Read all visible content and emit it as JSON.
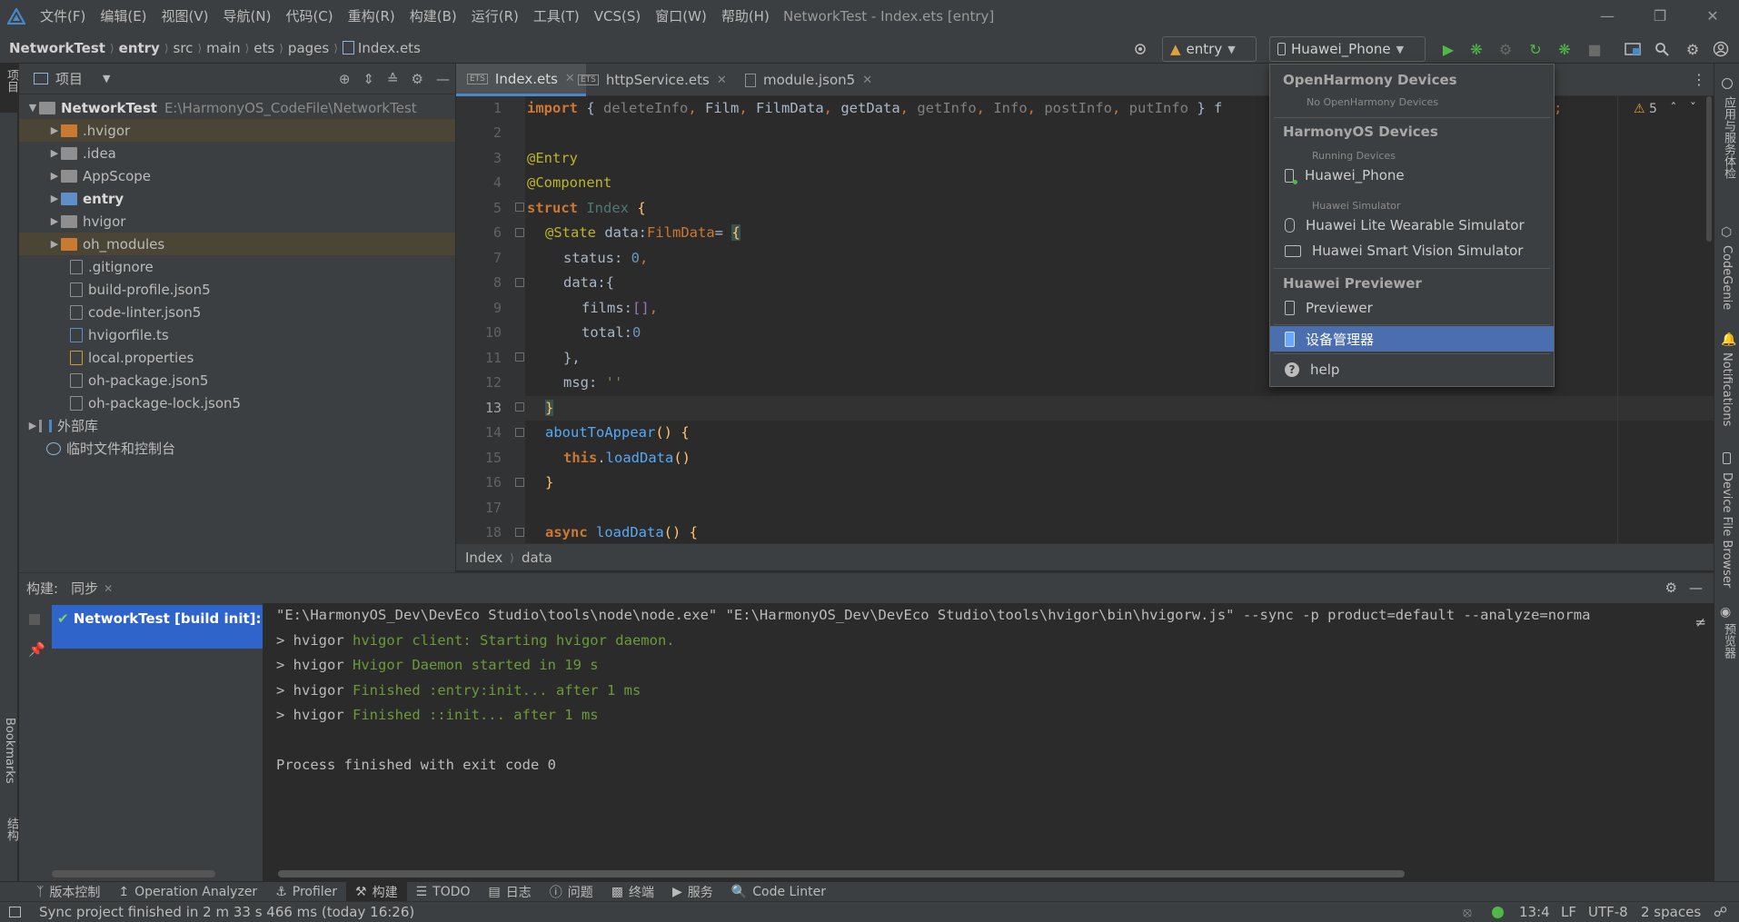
{
  "menubar": {
    "items": [
      "文件(F)",
      "编辑(E)",
      "视图(V)",
      "导航(N)",
      "代码(C)",
      "重构(R)",
      "构建(B)",
      "运行(R)",
      "工具(T)",
      "VCS(S)",
      "窗口(W)",
      "帮助(H)"
    ],
    "window_title": "NetworkTest - Index.ets [entry]"
  },
  "breadcrumb": [
    "NetworkTest",
    "entry",
    "src",
    "main",
    "ets",
    "pages",
    "Index.ets"
  ],
  "toolbar": {
    "module_select": "entry",
    "device_select": "Huawei_Phone"
  },
  "project_panel": {
    "title": "项目",
    "tree": [
      {
        "label": "NetworkTest",
        "path": "E:\\HarmonyOS_CodeFile\\NetworkTest",
        "depth": 0,
        "kind": "root"
      },
      {
        "label": ".hvigor",
        "depth": 1,
        "kind": "folder-orange"
      },
      {
        "label": ".idea",
        "depth": 1,
        "kind": "folder"
      },
      {
        "label": "AppScope",
        "depth": 1,
        "kind": "folder"
      },
      {
        "label": "entry",
        "depth": 1,
        "kind": "folder-blue"
      },
      {
        "label": "hvigor",
        "depth": 1,
        "kind": "folder"
      },
      {
        "label": "oh_modules",
        "depth": 1,
        "kind": "folder-orange"
      },
      {
        "label": ".gitignore",
        "depth": 1,
        "kind": "file"
      },
      {
        "label": "build-profile.json5",
        "depth": 1,
        "kind": "file"
      },
      {
        "label": "code-linter.json5",
        "depth": 1,
        "kind": "file"
      },
      {
        "label": "hvigorfile.ts",
        "depth": 1,
        "kind": "file"
      },
      {
        "label": "local.properties",
        "depth": 1,
        "kind": "file"
      },
      {
        "label": "oh-package.json5",
        "depth": 1,
        "kind": "file"
      },
      {
        "label": "oh-package-lock.json5",
        "depth": 1,
        "kind": "file"
      },
      {
        "label": "外部库",
        "depth": 0,
        "kind": "lib"
      },
      {
        "label": "临时文件和控制台",
        "depth": 0,
        "kind": "scratch"
      }
    ]
  },
  "editor": {
    "tabs": [
      "Index.ets",
      "httpService.ets",
      "module.json5"
    ],
    "warnings": "5",
    "line_numbers": [
      "1",
      "2",
      "3",
      "4",
      "5",
      "6",
      "7",
      "8",
      "9",
      "10",
      "11",
      "12",
      "13",
      "14",
      "15",
      "16",
      "17",
      "18"
    ],
    "code": {
      "l1_import": "import",
      "l1_a": "{ ",
      "l1_deleteInfo": "deleteInfo",
      "l1_film": "Film",
      "l1_filmdata": "FilmData",
      "l1_getdata": "getData",
      "l1_getinfo": "getInfo",
      "l1_info": "Info",
      "l1_postinfo": "postInfo",
      "l1_putinfo": "putInfo",
      "l1_end": " } f",
      "l1_semicolon": ";",
      "l4": "@Entry",
      "l5": "@Component",
      "l6_struct": "struct",
      "l6_name": "Index",
      "l6_brace": " {",
      "l7_state": "@State",
      "l7_var": " data:",
      "l7_type": "FilmData",
      "l7_eq": "= ",
      "l7_brace": "{",
      "l8_key": "status",
      "l8_val": "0",
      "l9": "data:{",
      "l10_key": "films",
      "l10_val": "[]",
      "l11_key": "total",
      "l11_val": "0",
      "l12": "},",
      "l13_key": "msg",
      "l13_val": "''",
      "l14": "}",
      "l15_fn": "aboutToAppear",
      "l15_rest": "() {",
      "l16_this": "this",
      "l16_fn": "loadData",
      "l16_rest": "()",
      "l17": "}",
      "l19_async": "async",
      "l19_fn": "loadData",
      "l19_rest": "() {"
    },
    "crumbs": [
      "Index",
      "data"
    ]
  },
  "build": {
    "label": "构建:",
    "tab": "同步",
    "tree_item": "NetworkTest [build init]: 成",
    "console": [
      "\"E:\\HarmonyOS_Dev\\DevEco Studio\\tools\\node\\node.exe\" \"E:\\HarmonyOS_Dev\\DevEco Studio\\tools\\hvigor\\bin\\hvigorw.js\" --sync -p product=default --analyze=norma",
      "> hvigor ",
      "hvigor client: Starting hvigor daemon.",
      "> hvigor ",
      "Hvigor Daemon started in 19 s",
      "> hvigor ",
      "Finished :entry:init... after 1 ms",
      "> hvigor ",
      "Finished ::init... after 1 ms",
      "Process finished with exit code 0"
    ]
  },
  "bottom_tools": [
    "版本控制",
    "Operation Analyzer",
    "Profiler",
    "构建",
    "TODO",
    "日志",
    "问题",
    "终端",
    "服务",
    "Code Linter"
  ],
  "status": {
    "message": "Sync project finished in 2 m 33 s 466 ms (today 16:26)",
    "position": "13:4",
    "line_sep": "LF",
    "encoding": "UTF-8",
    "indent": "2 spaces"
  },
  "left_strip": {
    "project": "项目",
    "bookmarks": "Bookmarks",
    "structure": "结构"
  },
  "right_strip": {
    "app_service": "应用与服务体检",
    "codegenie": "CodeGenie",
    "notifications": "Notifications",
    "device_file_browser": "Device File Browser",
    "preview": "预览器"
  },
  "device_popup": {
    "h_openharmony": "OpenHarmony Devices",
    "no_openharmony": "No OpenHarmony Devices",
    "h_harmonyos": "HarmonyOS Devices",
    "running": "Running Devices",
    "phone": "Huawei_Phone",
    "simulator": "Huawei Simulator",
    "wearable": "Huawei Lite Wearable Simulator",
    "vision": "Huawei Smart Vision Simulator",
    "h_previewer": "Huawei Previewer",
    "previewer": "Previewer",
    "device_manager": "设备管理器",
    "help": "help"
  },
  "colors": {
    "accent": "#4b6eaf",
    "build_selection": "#2f65ca",
    "run_green": "#4fb846"
  }
}
